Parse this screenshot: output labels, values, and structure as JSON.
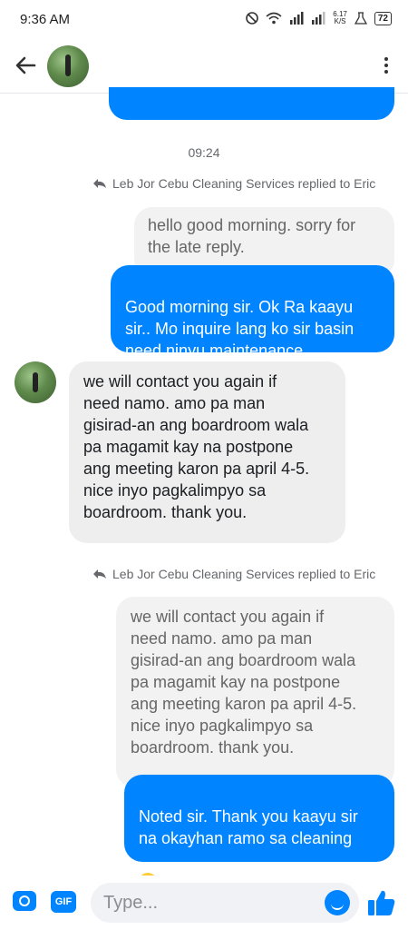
{
  "status": {
    "time": "9:36 AM",
    "speed_value": "6.17",
    "speed_unit": "K/S",
    "battery": "72"
  },
  "colors": {
    "accent": "#0084ff",
    "incoming_bg": "#eeeeef",
    "quoted_bg": "#f2f2f3"
  },
  "header": {
    "icons": [
      "back-arrow-icon",
      "contact-avatar",
      "more-options-icon"
    ]
  },
  "conversation": {
    "time_separator": "09:24",
    "reply_note_1": "Leb Jor Cebu Cleaning Services replied to Eric",
    "quoted_1": "hello good morning. sorry for\nthe late reply.",
    "outgoing_1": "Good morning sir. Ok Ra kaayu\nsir.. Mo inquire lang ko sir basin\nneed ninyu maintenance",
    "incoming_1": "we will contact you again if\nneed namo. amo pa man\ngisirad-an ang boardroom wala\npa magamit kay na postpone\nang meeting karon pa april 4-5.\nnice inyo pagkalimpyo sa\nboardroom. thank you.",
    "reply_note_2": "Leb Jor Cebu Cleaning Services replied to Eric",
    "quoted_2": "we will contact you again if\nneed namo. amo pa man\ngisirad-an ang boardroom wala\npa magamit kay na postpone\nang meeting karon pa april 4-5.\nnice inyo pagkalimpyo sa\nboardroom. thank you.",
    "outgoing_2": "Noted sir. Thank you kaayu sir\nna okayhan ramo sa cleaning"
  },
  "composer": {
    "gif_label": "GIF",
    "placeholder": "Type..."
  }
}
